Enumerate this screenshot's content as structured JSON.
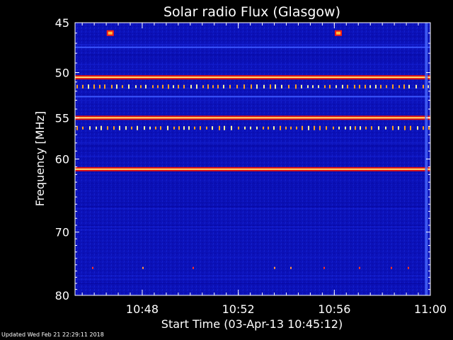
{
  "chart_data": {
    "type": "heatmap",
    "title": "Solar radio Flux (Glasgow)",
    "xlabel": "Start Time (03-Apr-13 10:45:12)",
    "ylabel": "Frequency [MHz]",
    "x_range": [
      "10:45:12",
      "11:00:00"
    ],
    "x_ticks": [
      "10:48",
      "10:52",
      "10:56",
      "11:00"
    ],
    "y_range": [
      45,
      80
    ],
    "y_scale": "log",
    "y_ticks": [
      45,
      50,
      55,
      60,
      70,
      80
    ],
    "y_tick_labels": [
      "45",
      "50",
      "55",
      "60",
      "70",
      "80"
    ],
    "grid": false,
    "colormap": [
      "#0000aa",
      "#1a2cff",
      "#ff0000",
      "#ffffff"
    ],
    "features": [
      {
        "kind": "persistent-band",
        "frequency_mhz": 47.4,
        "intensity": "low"
      },
      {
        "kind": "persistent-band",
        "frequency_mhz": 50.5,
        "intensity": "high"
      },
      {
        "kind": "intermittent-band",
        "frequency_mhz": 51.5,
        "intensity": "high"
      },
      {
        "kind": "persistent-band",
        "frequency_mhz": 52.6,
        "intensity": "low"
      },
      {
        "kind": "persistent-band",
        "frequency_mhz": 55.0,
        "intensity": "high"
      },
      {
        "kind": "intermittent-band",
        "frequency_mhz": 56.2,
        "intensity": "high"
      },
      {
        "kind": "persistent-band",
        "frequency_mhz": 61.3,
        "intensity": "high"
      },
      {
        "kind": "intermittent-band",
        "frequency_mhz": 75.5,
        "intensity": "medium"
      },
      {
        "kind": "burst",
        "frequency_mhz": 46.0,
        "time": "10:46:40",
        "intensity": "high"
      },
      {
        "kind": "burst",
        "frequency_mhz": 46.0,
        "time": "10:56:10",
        "intensity": "high"
      },
      {
        "kind": "vertical-stripe",
        "time": "10:59:50",
        "intensity": "low"
      }
    ]
  },
  "footer": {
    "text": "Updated Wed Feb 21 22:29:11 2018"
  }
}
